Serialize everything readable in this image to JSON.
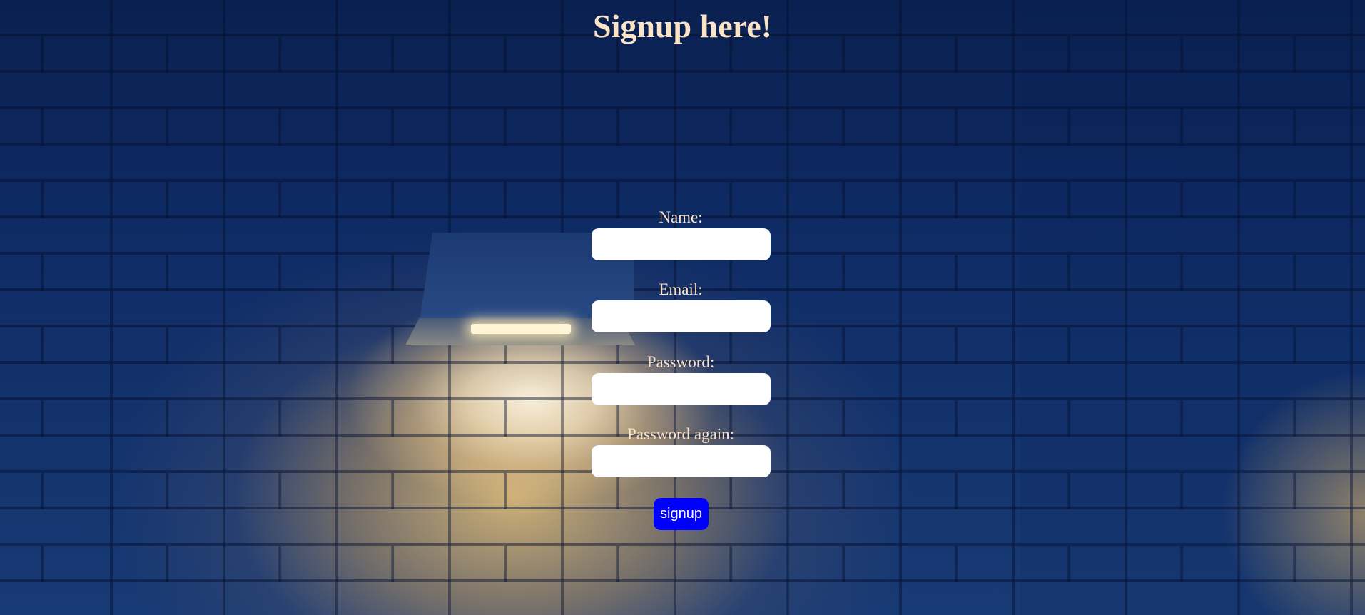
{
  "page": {
    "title": "Signup here!"
  },
  "form": {
    "name_label": "Name:",
    "name_value": "",
    "email_label": "Email:",
    "email_value": "",
    "password_label": "Password:",
    "password_value": "",
    "password_again_label": "Password again:",
    "password_again_value": "",
    "submit_label": "signup"
  },
  "colors": {
    "text": "#fbe3c7",
    "button": "#0000ff",
    "button_text": "#ffffff",
    "input_background": "#ffffff",
    "wall": "#0f2a5c"
  }
}
